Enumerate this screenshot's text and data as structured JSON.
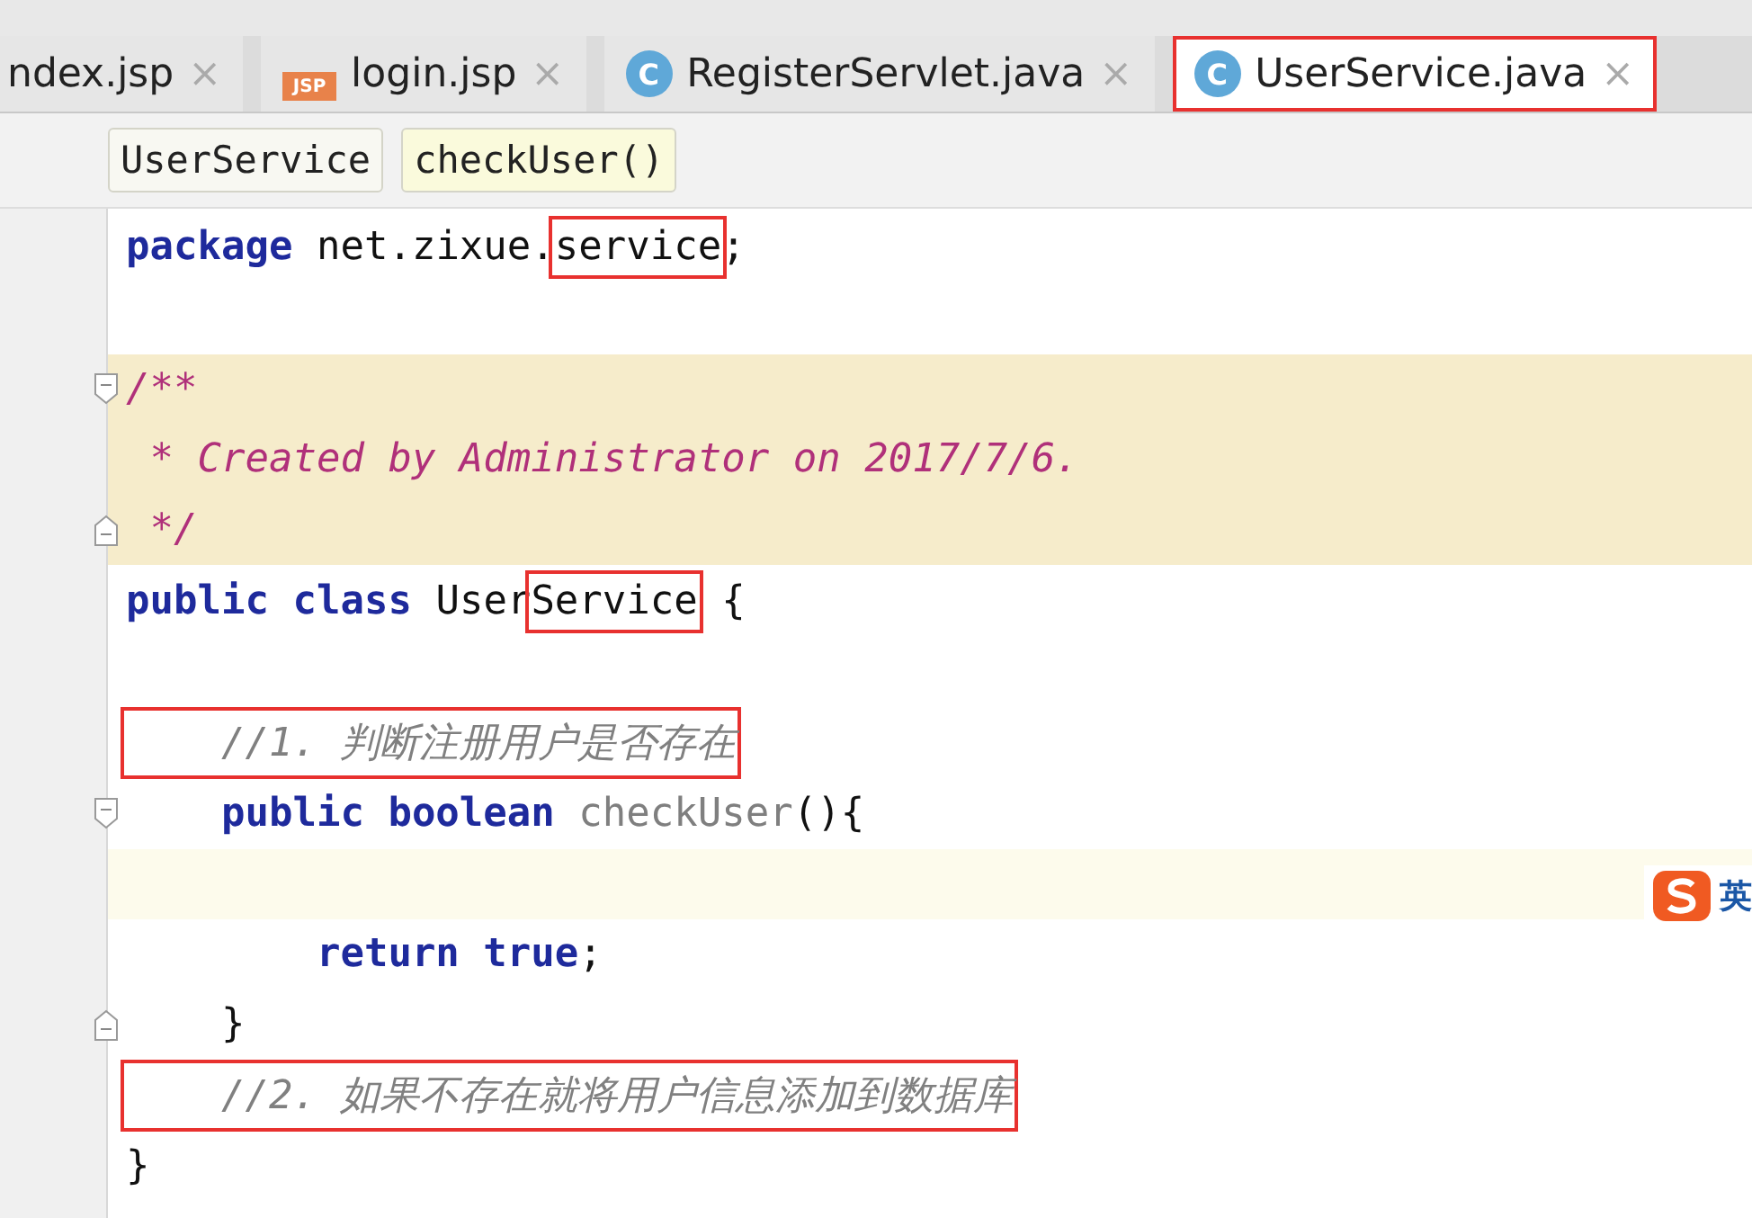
{
  "tabs": [
    {
      "label": "ndex.jsp",
      "kind": "plain",
      "close": "×",
      "selected": false,
      "boxed": false
    },
    {
      "label": "login.jsp",
      "kind": "jsp",
      "icon_text": "JSP",
      "close": "×",
      "selected": false,
      "boxed": false
    },
    {
      "label": "RegisterServlet.java",
      "kind": "class",
      "icon_text": "C",
      "close": "×",
      "selected": false,
      "boxed": false
    },
    {
      "label": "UserService.java",
      "kind": "class",
      "icon_text": "C",
      "close": "×",
      "selected": true,
      "boxed": true
    }
  ],
  "breadcrumbs": [
    {
      "label": "UserService",
      "selected": false
    },
    {
      "label": "checkUser()",
      "selected": true
    }
  ],
  "lines": [
    {
      "kind": "code",
      "fold_start": false,
      "fold_end": false,
      "tokens": [
        {
          "text": "package",
          "kind": "keyword",
          "boxed": false
        },
        {
          "text": " net.zixue.",
          "kind": "plain",
          "boxed": false
        },
        {
          "text": "service",
          "kind": "plain",
          "boxed": true
        },
        {
          "text": ";",
          "kind": "plain",
          "boxed": false
        }
      ]
    },
    {
      "kind": "blank",
      "fold_start": false,
      "fold_end": false
    },
    {
      "kind": "doc",
      "fold_start": true,
      "fold_end": false,
      "tokens": [
        {
          "text": "/**",
          "kind": "doc",
          "boxed": false
        }
      ]
    },
    {
      "kind": "doc",
      "fold_start": false,
      "fold_end": false,
      "tokens": [
        {
          "text": " * Created by Administrator on 2017/7/6.",
          "kind": "doc",
          "boxed": false
        }
      ]
    },
    {
      "kind": "doc",
      "fold_start": false,
      "fold_end": true,
      "tokens": [
        {
          "text": " */",
          "kind": "doc",
          "boxed": false
        }
      ]
    },
    {
      "kind": "code",
      "fold_start": false,
      "fold_end": false,
      "tokens": [
        {
          "text": "public class",
          "kind": "keyword",
          "boxed": false
        },
        {
          "text": " User",
          "kind": "plain",
          "boxed": false
        },
        {
          "text": "Service",
          "kind": "plain",
          "boxed": true
        },
        {
          "text": " {",
          "kind": "plain",
          "boxed": false
        }
      ]
    },
    {
      "kind": "blank",
      "fold_start": false,
      "fold_end": false
    },
    {
      "kind": "code",
      "fold_start": false,
      "fold_end": false,
      "tokens": [
        {
          "text": "    //1. 判断注册用户是否存在",
          "kind": "comment",
          "boxed": true
        }
      ]
    },
    {
      "kind": "code",
      "fold_start": true,
      "fold_end": false,
      "tokens": [
        {
          "text": "    public boolean",
          "kind": "keyword",
          "boxed": false
        },
        {
          "text": " checkUser",
          "kind": "unused",
          "boxed": false
        },
        {
          "text": "(){",
          "kind": "plain",
          "boxed": false
        }
      ]
    },
    {
      "kind": "current",
      "fold_start": false,
      "fold_end": false
    },
    {
      "kind": "code",
      "fold_start": false,
      "fold_end": false,
      "tokens": [
        {
          "text": "        return true",
          "kind": "keyword",
          "boxed": false
        },
        {
          "text": ";",
          "kind": "plain",
          "boxed": false
        }
      ]
    },
    {
      "kind": "code",
      "fold_start": false,
      "fold_end": true,
      "tokens": [
        {
          "text": "    }",
          "kind": "plain",
          "boxed": false
        }
      ]
    },
    {
      "kind": "code",
      "fold_start": false,
      "fold_end": false,
      "tokens": [
        {
          "text": "    //2. 如果不存在就将用户信息添加到数据库",
          "kind": "comment",
          "boxed": true
        }
      ]
    },
    {
      "kind": "code",
      "fold_start": false,
      "fold_end": false,
      "tokens": [
        {
          "text": "}",
          "kind": "plain",
          "boxed": false
        }
      ]
    }
  ],
  "ime": {
    "label": "英"
  }
}
